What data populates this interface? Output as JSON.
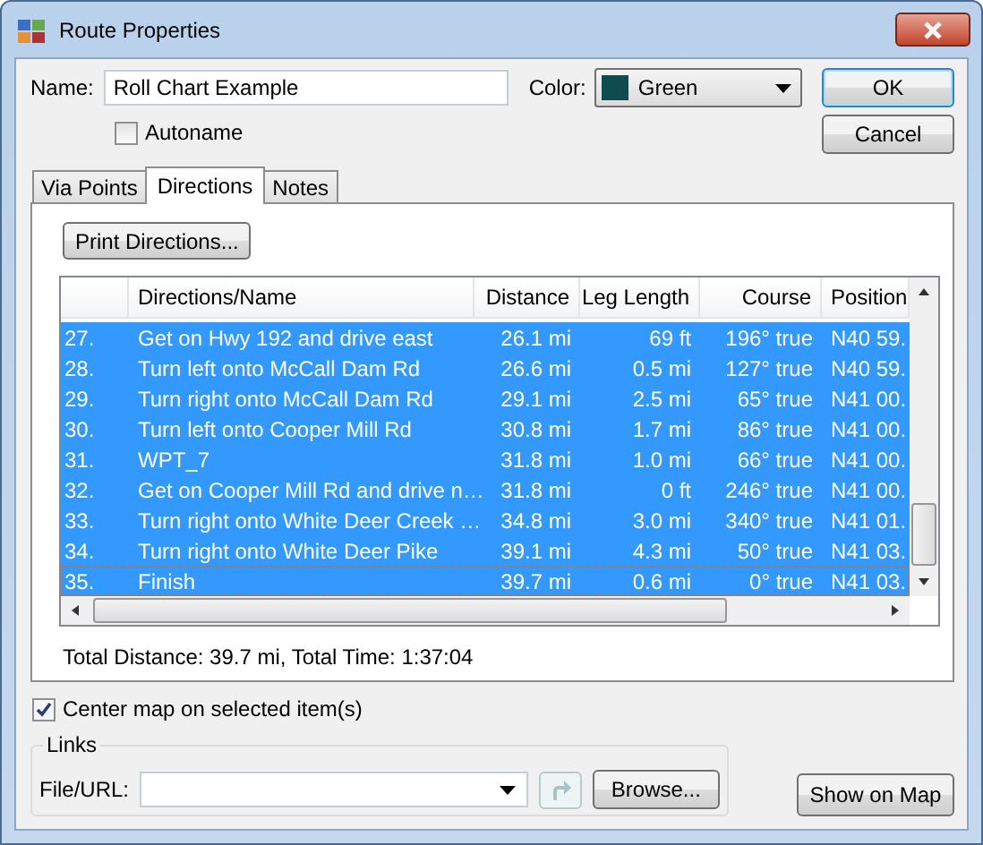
{
  "window": {
    "title": "Route Properties"
  },
  "name": {
    "label": "Name:",
    "value": "Roll Chart Example"
  },
  "color": {
    "label": "Color:",
    "value": "Green"
  },
  "autoname": {
    "label": "Autoname",
    "checked": false
  },
  "buttons": {
    "ok": "OK",
    "cancel": "Cancel",
    "show_on_map": "Show on Map",
    "browse": "Browse...",
    "print": "Print Directions..."
  },
  "tabs": [
    {
      "label": "Via Points",
      "selected": false
    },
    {
      "label": "Directions",
      "selected": true
    },
    {
      "label": "Notes",
      "selected": false
    }
  ],
  "table": {
    "columns": [
      "Directions/Name",
      "Distance",
      "Leg Length",
      "Course",
      "Position"
    ],
    "rows": [
      {
        "num": "27.",
        "name": "Get on Hwy 192 and drive east",
        "distance": "26.1 mi",
        "leg": "69 ft",
        "course": "196° true",
        "position": "N40 59.",
        "selected": true,
        "focused": false
      },
      {
        "num": "28.",
        "name": "Turn left onto McCall Dam Rd",
        "distance": "26.6 mi",
        "leg": "0.5 mi",
        "course": "127° true",
        "position": "N40 59.",
        "selected": true,
        "focused": false
      },
      {
        "num": "29.",
        "name": "Turn right onto McCall Dam Rd",
        "distance": "29.1 mi",
        "leg": "2.5 mi",
        "course": "65° true",
        "position": "N41 00.",
        "selected": true,
        "focused": false
      },
      {
        "num": "30.",
        "name": "Turn left onto Cooper Mill Rd",
        "distance": "30.8 mi",
        "leg": "1.7 mi",
        "course": "86° true",
        "position": "N41 00.",
        "selected": true,
        "focused": false
      },
      {
        "num": "31.",
        "name": "WPT_7",
        "distance": "31.8 mi",
        "leg": "1.0 mi",
        "course": "66° true",
        "position": "N41 00.",
        "selected": true,
        "focused": false
      },
      {
        "num": "32.",
        "name": "Get on Cooper Mill Rd and drive n…",
        "distance": "31.8 mi",
        "leg": "0 ft",
        "course": "246° true",
        "position": "N41 00.",
        "selected": true,
        "focused": false
      },
      {
        "num": "33.",
        "name": "Turn right onto White Deer Creek …",
        "distance": "34.8 mi",
        "leg": "3.0 mi",
        "course": "340° true",
        "position": "N41 01.",
        "selected": true,
        "focused": false
      },
      {
        "num": "34.",
        "name": "Turn right onto White Deer Pike",
        "distance": "39.1 mi",
        "leg": "4.3 mi",
        "course": "50° true",
        "position": "N41 03.",
        "selected": true,
        "focused": false
      },
      {
        "num": "35.",
        "name": "Finish",
        "distance": "39.7 mi",
        "leg": "0.6 mi",
        "course": "0° true",
        "position": "N41 03.",
        "selected": true,
        "focused": true
      }
    ]
  },
  "totals": "Total Distance: 39.7 mi, Total Time: 1:37:04",
  "center_map": {
    "label": "Center map on selected item(s)",
    "checked": true
  },
  "links": {
    "title": "Links",
    "label": "File/URL:"
  }
}
